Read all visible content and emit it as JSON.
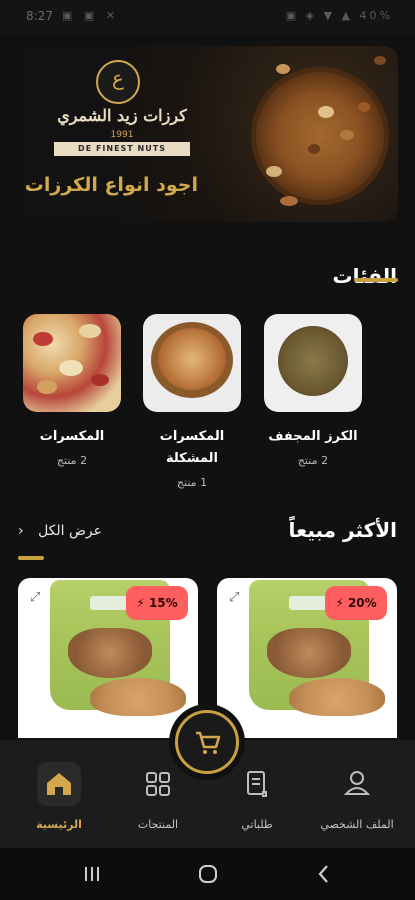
{
  "status": {
    "time": "8:27",
    "left_icons": "▣ ▣ ✕",
    "right_icons": "▣ ◈ ▼ ▲ 40%"
  },
  "banner": {
    "brand": "كرزات زيد الشمري",
    "year": "1991",
    "ribbon": "DE FINEST NUTS",
    "tagline": "اجود انواع الكرزات"
  },
  "categories_section": {
    "title": "الفئات"
  },
  "categories": [
    {
      "name": "الكرز المجفف",
      "count": "2 منتج",
      "icon": "dried-nuts-image"
    },
    {
      "name": "المكسرات المشكلة",
      "count": "1 منتج",
      "icon": "mixed-nuts-bowl-image"
    },
    {
      "name": "المكسرات",
      "count": "2 منتج",
      "icon": "nuts-image"
    }
  ],
  "bestsellers_section": {
    "title": "الأكثر مبيعاً",
    "view_all": "عرض الكل"
  },
  "products": [
    {
      "discount": "20%",
      "icon": "nuts-bag-image"
    },
    {
      "discount": "15%",
      "icon": "nuts-bag-image"
    }
  ],
  "bottom_nav": [
    {
      "label": "الملف الشخصي",
      "icon": "user-icon"
    },
    {
      "label": "طلباتي",
      "icon": "receipt-icon"
    },
    {
      "label": "المنتجات",
      "icon": "grid-icon"
    },
    {
      "label": "الرئيسية",
      "icon": "home-icon",
      "active": true
    }
  ],
  "colors": {
    "accent": "#c9a040",
    "background": "#111111",
    "badge": "#ff5e5e"
  }
}
